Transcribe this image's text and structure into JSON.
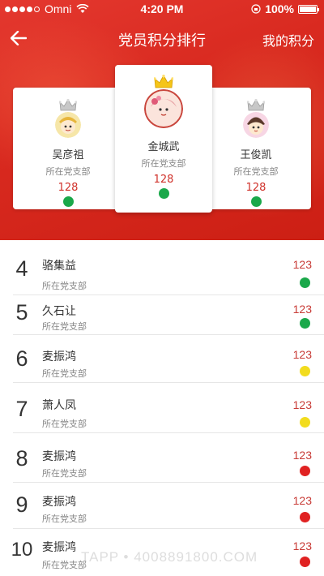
{
  "status_bar": {
    "carrier": "Omni",
    "time": "4:20 PM",
    "battery": "100%"
  },
  "nav": {
    "title": "党员积分排行",
    "right_label": "我的积分",
    "back_icon": "arrow-left-icon"
  },
  "top3": [
    {
      "name": "吴彦祖",
      "dept": "所在党支部",
      "score": "128",
      "status_color": "#1aa84a",
      "crown": "silver"
    },
    {
      "name": "金城武",
      "dept": "所在党支部",
      "score": "128",
      "status_color": "#1aa84a",
      "crown": "gold"
    },
    {
      "name": "王俊凯",
      "dept": "所在党支部",
      "score": "128",
      "status_color": "#1aa84a",
      "crown": "silver"
    }
  ],
  "ranking": [
    {
      "rank": "4",
      "name": "骆集益",
      "dept": "所在党支部",
      "score": "123",
      "status_color": "#1aa84a"
    },
    {
      "rank": "5",
      "name": "久石让",
      "dept": "所在党支部",
      "score": "123",
      "status_color": "#1aa84a"
    },
    {
      "rank": "6",
      "name": "麦振鸿",
      "dept": "所在党支部",
      "score": "123",
      "status_color": "#f2dc1e"
    },
    {
      "rank": "7",
      "name": "萧人凤",
      "dept": "所在党支部",
      "score": "123",
      "status_color": "#f2dc1e"
    },
    {
      "rank": "8",
      "name": "麦振鸿",
      "dept": "所在党支部",
      "score": "123",
      "status_color": "#e02222"
    },
    {
      "rank": "9",
      "name": "麦振鸿",
      "dept": "所在党支部",
      "score": "123",
      "status_color": "#e02222"
    },
    {
      "rank": "10",
      "name": "麦振鸿",
      "dept": "所在党支部",
      "score": "123",
      "status_color": "#e02222"
    }
  ],
  "watermark": "TAPP • 4008891800.COM",
  "colors": {
    "accent_red": "#d92a20",
    "score_red": "#c83b36",
    "green": "#1aa84a",
    "yellow": "#f2dc1e",
    "red": "#e02222"
  }
}
